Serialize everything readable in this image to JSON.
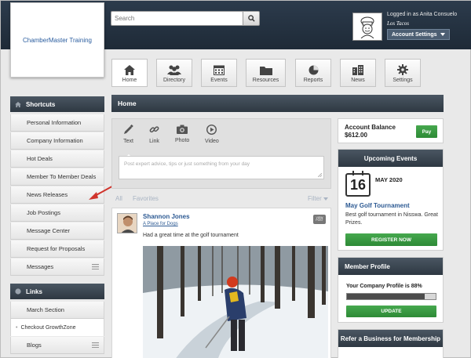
{
  "header": {
    "logo_text": "ChamberMaster Training",
    "search_placeholder": "Search",
    "login_text": "Logged in as Anita Consuelo",
    "company": "Los Tacos",
    "account_settings": "Account Settings"
  },
  "nav": [
    {
      "label": "Home",
      "icon": "home-icon"
    },
    {
      "label": "Directory",
      "icon": "people-icon"
    },
    {
      "label": "Events",
      "icon": "calendar-icon"
    },
    {
      "label": "Resources",
      "icon": "folder-icon"
    },
    {
      "label": "Reports",
      "icon": "pie-chart-icon"
    },
    {
      "label": "News",
      "icon": "building-icon"
    },
    {
      "label": "Settings",
      "icon": "gear-icon"
    }
  ],
  "sidebar": {
    "shortcuts_title": "Shortcuts",
    "items": [
      "Personal Information",
      "Company Information",
      "Hot Deals",
      "Member To Member Deals",
      "News Releases",
      "Job Postings",
      "Message Center",
      "Request for Proposals",
      "Messages"
    ],
    "links_title": "Links",
    "links": [
      {
        "label": "March Section",
        "type": "item"
      },
      {
        "label": "Checkout GrowthZone",
        "type": "sub"
      },
      {
        "label": "Blogs",
        "type": "item"
      }
    ]
  },
  "main": {
    "title": "Home",
    "post_types": [
      "Text",
      "Link",
      "Photo",
      "Video"
    ],
    "post_placeholder": "Post expert advice, tips or just something from your day",
    "filters": {
      "all": "All",
      "favorites": "Favorites",
      "filter": "Filter"
    },
    "feed": {
      "author": "Shannon Jones",
      "company": "A Place for Dogs",
      "view_post": "VIEW POST",
      "message": "Had a great time at the golf tournament"
    }
  },
  "right": {
    "balance_label": "Account Balance",
    "balance_value": "$612.00",
    "pay": "Pay",
    "events_title": "Upcoming Events",
    "event_day": "16",
    "event_month": "MAY 2020",
    "event_title": "May Golf Tournament",
    "event_desc": "Best golf tournament in Nisswa. Great Prizes.",
    "register": "REGISTER NOW",
    "profile_title": "Member Profile",
    "profile_text": "Your Company Profile is 88%",
    "profile_percent": 88,
    "update": "UPDATE",
    "refer_title": "Refer a Business for Membership"
  },
  "colors": {
    "header_dark": "#1e2a37",
    "link_blue": "#2d5a93",
    "green": "#2d8a36",
    "arrow_red": "#d0342c"
  }
}
